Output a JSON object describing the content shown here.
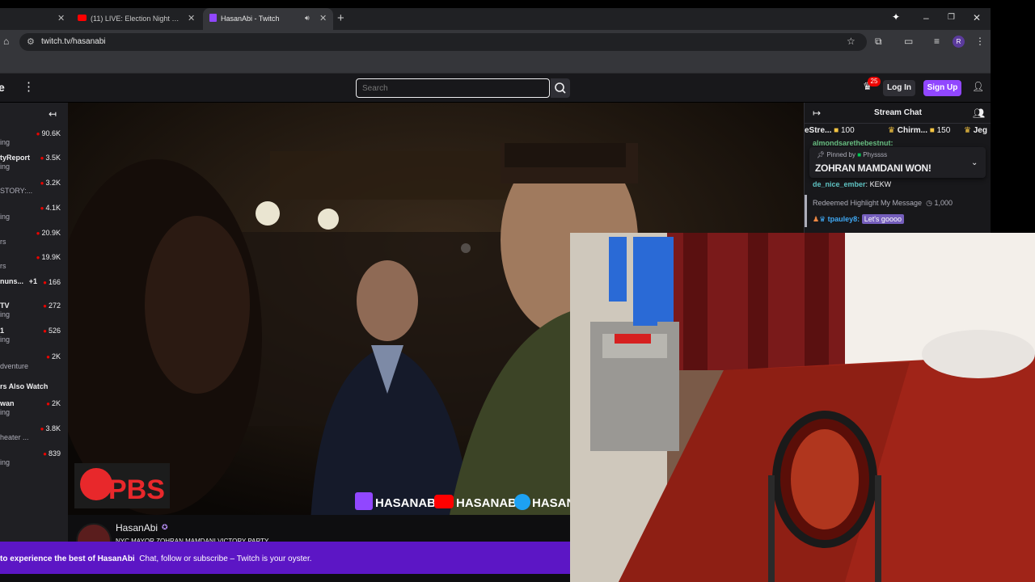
{
  "browser": {
    "tabs": [
      {
        "title": "",
        "active": false
      },
      {
        "title": "(11) LIVE: Election Night 2025 |",
        "icon": "youtube-icon",
        "active": false
      },
      {
        "title": "HasanAbi - Twitch",
        "icon": "twitch-icon",
        "active": true,
        "audio": true
      }
    ],
    "new_tab_label": "+",
    "url": "twitch.tv/hasanabi",
    "profile_initial": "R"
  },
  "twitch_nav": {
    "left_edge_text": "e",
    "search_placeholder": "Search",
    "notification_count": "25",
    "login_label": "Log In",
    "signup_label": "Sign Up"
  },
  "sidebar": {
    "items": [
      {
        "name": "",
        "category": "ing",
        "viewers": "90.6K"
      },
      {
        "name": "tyReport",
        "category": "ing",
        "viewers": "3.5K"
      },
      {
        "name": "STORY:...",
        "category": "",
        "viewers": "3.2K"
      },
      {
        "name": "",
        "category": "ing",
        "viewers": "4.1K"
      },
      {
        "name": "",
        "category": "rs",
        "viewers": "20.9K"
      },
      {
        "name": "",
        "category": "rs",
        "viewers": "19.9K"
      },
      {
        "name": "nuns...",
        "category": "",
        "viewers": "166",
        "extra": "+1"
      },
      {
        "name": "TV",
        "category": "ing",
        "viewers": "272"
      },
      {
        "name": "1",
        "category": "ing",
        "viewers": "526"
      },
      {
        "name": "",
        "category": "dventure",
        "viewers": "2K"
      }
    ],
    "also_watch_heading": "rs Also Watch",
    "also_watch_items": [
      {
        "name": "wan",
        "category": "ing",
        "viewers": "2K"
      },
      {
        "name": "",
        "category": "heater ...",
        "viewers": "3.8K"
      },
      {
        "name": "",
        "category": "ing",
        "viewers": "839"
      }
    ]
  },
  "video": {
    "logo_text": "PBS",
    "socials": [
      "HASANABI",
      "HASANABI",
      "HASAN"
    ]
  },
  "channel": {
    "name": "HasanAbi",
    "title": "NYC MAYOR ZOHRAN MAMDANI VICTORY PARTY"
  },
  "chat": {
    "title": "Stream Chat",
    "leaderboard": [
      {
        "name": "eStre...",
        "amount": "100"
      },
      {
        "name": "Chirm...",
        "amount": "150"
      },
      {
        "name": "Jeg",
        "amount": ""
      }
    ],
    "behind_line": "almondsarethebestnut:",
    "pinned_by_label": "Pinned by",
    "pinned_by_user": "Physsss",
    "pinned_message": "ZOHRAN MAMDANI WON!",
    "line_user": "de_nice_ember",
    "line_msg": "KEKW",
    "redeem_label": "Redeemed Highlight My Message",
    "redeem_cost": "1,000",
    "highlight_user": "tpauley8:",
    "highlight_msg": "Let's goooo"
  },
  "promo": {
    "bold": "to experience the best of HasanAbi",
    "text": "Chat, follow or subscribe – Twitch is your oyster."
  },
  "colors": {
    "twitch_purple": "#9147ff",
    "promo_purple": "#5c16c5",
    "live_red": "#eb0400",
    "highlight_purple": "#755ebc"
  }
}
